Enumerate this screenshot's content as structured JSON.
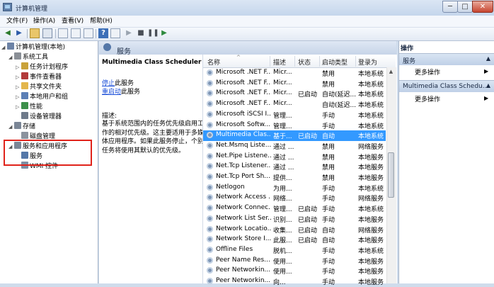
{
  "window": {
    "title": "计算机管理",
    "min": "─",
    "max": "□",
    "close": "✕"
  },
  "menu": [
    "文件(F)",
    "操作(A)",
    "查看(V)",
    "帮助(H)"
  ],
  "tree": [
    {
      "label": "计算机管理(本地)",
      "indent": 0,
      "tri": "◢",
      "color": "#6d83a6"
    },
    {
      "label": "系统工具",
      "indent": 1,
      "tri": "◢",
      "color": "#8a8f96"
    },
    {
      "label": "任务计划程序",
      "indent": 2,
      "tri": "▷",
      "color": "#c9a23a"
    },
    {
      "label": "事件查看器",
      "indent": 2,
      "tri": "▷",
      "color": "#b23a3a"
    },
    {
      "label": "共享文件夹",
      "indent": 2,
      "tri": "▷",
      "color": "#e3b64c"
    },
    {
      "label": "本地用户和组",
      "indent": 2,
      "tri": "▷",
      "color": "#5b7fb6"
    },
    {
      "label": "性能",
      "indent": 2,
      "tri": "▷",
      "color": "#3c8f4a"
    },
    {
      "label": "设备管理器",
      "indent": 2,
      "tri": "",
      "color": "#6e7a8a"
    },
    {
      "label": "存储",
      "indent": 1,
      "tri": "◢",
      "color": "#7b8696"
    },
    {
      "label": "磁盘管理",
      "indent": 2,
      "tri": "",
      "color": "#8b939e"
    },
    {
      "label": "服务和应用程序",
      "indent": 1,
      "tri": "◢",
      "color": "#7b8696"
    },
    {
      "label": "服务",
      "indent": 2,
      "tri": "",
      "color": "#5477a8"
    },
    {
      "label": "WMI 控件",
      "indent": 2,
      "tri": "",
      "color": "#7d8ea3"
    }
  ],
  "center": {
    "title": "服务",
    "service_name": "Multimedia Class Scheduler",
    "stop_link": "停止",
    "stop_suffix": "此服务",
    "restart_link": "重启动",
    "restart_suffix": "此服务",
    "desc_label": "描述:",
    "desc_lines": [
      "基于系统范围内的任务优先级启用工",
      "作的相对优先级。这主要适用于多媒",
      "体应用程序。如果此服务停止，个别",
      "任务将使用其默认的优先级。"
    ]
  },
  "columns": [
    "名称",
    "描述",
    "状态",
    "启动类型",
    "登录为"
  ],
  "services": [
    {
      "name": "Microsoft .NET F...",
      "desc": "Micr...",
      "status": "",
      "startup": "禁用",
      "logon": "本地系统"
    },
    {
      "name": "Microsoft .NET F...",
      "desc": "Micr...",
      "status": "",
      "startup": "禁用",
      "logon": "本地系统"
    },
    {
      "name": "Microsoft .NET F...",
      "desc": "Micr...",
      "status": "已启动",
      "startup": "自动(延迟...",
      "logon": "本地系统"
    },
    {
      "name": "Microsoft .NET F...",
      "desc": "Micr...",
      "status": "",
      "startup": "自动(延迟...",
      "logon": "本地系统"
    },
    {
      "name": "Microsoft iSCSI I...",
      "desc": "管理...",
      "status": "",
      "startup": "手动",
      "logon": "本地系统"
    },
    {
      "name": "Microsoft Softw...",
      "desc": "管理...",
      "status": "",
      "startup": "手动",
      "logon": "本地系统"
    },
    {
      "name": "Multimedia Clas...",
      "desc": "基于...",
      "status": "已启动",
      "startup": "自动",
      "logon": "本地系统",
      "selected": true
    },
    {
      "name": "Net.Msmq Liste...",
      "desc": "通过 ...",
      "status": "",
      "startup": "禁用",
      "logon": "网络服务"
    },
    {
      "name": "Net.Pipe Listene...",
      "desc": "通过 ...",
      "status": "",
      "startup": "禁用",
      "logon": "本地服务"
    },
    {
      "name": "Net.Tcp Listener...",
      "desc": "通过 ...",
      "status": "",
      "startup": "禁用",
      "logon": "本地服务"
    },
    {
      "name": "Net.Tcp Port Sh...",
      "desc": "提供...",
      "status": "",
      "startup": "禁用",
      "logon": "本地服务"
    },
    {
      "name": "Netlogon",
      "desc": "为用...",
      "status": "",
      "startup": "手动",
      "logon": "本地系统"
    },
    {
      "name": "Network Access ...",
      "desc": "网络...",
      "status": "",
      "startup": "手动",
      "logon": "网络服务"
    },
    {
      "name": "Network Connec...",
      "desc": "管理...",
      "status": "已启动",
      "startup": "手动",
      "logon": "本地系统"
    },
    {
      "name": "Network List Ser...",
      "desc": "识别...",
      "status": "已启动",
      "startup": "手动",
      "logon": "本地服务"
    },
    {
      "name": "Network Locatio...",
      "desc": "收集...",
      "status": "已启动",
      "startup": "自动",
      "logon": "网络服务"
    },
    {
      "name": "Network Store I...",
      "desc": "此服...",
      "status": "已启动",
      "startup": "自动",
      "logon": "本地服务"
    },
    {
      "name": "Offline Files",
      "desc": "脱机...",
      "status": "",
      "startup": "手动",
      "logon": "本地系统"
    },
    {
      "name": "Peer Name Res...",
      "desc": "使用...",
      "status": "",
      "startup": "手动",
      "logon": "本地服务"
    },
    {
      "name": "Peer Networkin...",
      "desc": "使用...",
      "status": "",
      "startup": "手动",
      "logon": "本地服务"
    },
    {
      "name": "Peer Networkin...",
      "desc": "向...",
      "status": "",
      "startup": "手动",
      "logon": "本地服务"
    }
  ],
  "actions": {
    "title": "操作",
    "sections": [
      {
        "header": "服务",
        "item": "更多操作"
      },
      {
        "header": "Multimedia Class Schedu...",
        "item": "更多操作"
      }
    ]
  },
  "colors": {
    "selection": "#3399ff",
    "highlight_box": "#e0231b",
    "link": "#1a4ed8"
  }
}
